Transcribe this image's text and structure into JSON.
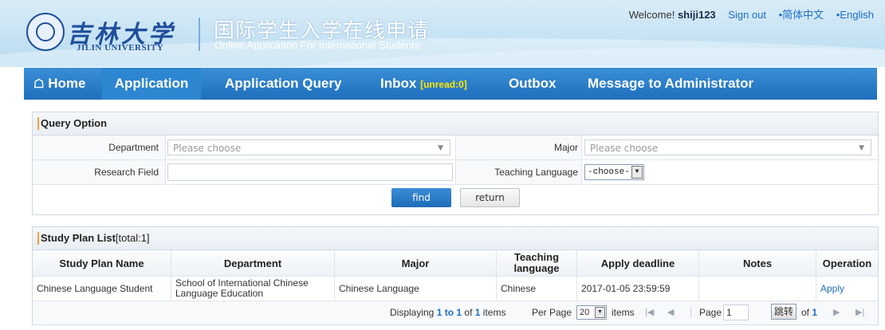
{
  "header": {
    "logo_cn": "吉林大学",
    "logo_en": "JILIN UNIVERSITY",
    "title_cn": "国际学生入学在线申请",
    "title_en": "Online Application For International Students",
    "welcome_prefix": "Welcome!",
    "username": "shiji123",
    "sign_out": "Sign out",
    "lang_cn": "•简体中文",
    "lang_en": "•English"
  },
  "nav": {
    "home": "Home",
    "application": "Application",
    "application_query": "Application Query",
    "inbox": "Inbox",
    "inbox_unread": "[unread:0]",
    "outbox": "Outbox",
    "message_admin": "Message to Administrator"
  },
  "query": {
    "title": "Query Option",
    "department_label": "Department",
    "department_value": "Please choose",
    "major_label": "Major",
    "major_value": "Please choose",
    "research_label": "Research Field",
    "research_value": "",
    "teaching_label": "Teaching Language",
    "teaching_value": "-choose-",
    "find": "find",
    "return": "return"
  },
  "list": {
    "title": "Study Plan List",
    "total": "[total:1]",
    "columns": [
      "Study Plan Name",
      "Department",
      "Major",
      "Teaching language",
      "Apply deadline",
      "Notes",
      "Operation"
    ],
    "rows": [
      {
        "name": "Chinese Language Student",
        "department": "School of International Chinese Language Education",
        "major": "Chinese Language",
        "language": "Chinese",
        "deadline": "2017-01-05 23:59:59",
        "notes": "",
        "operation": "Apply"
      }
    ]
  },
  "pager": {
    "displaying": "Displaying",
    "range": "1 to 1",
    "of": "of",
    "total": "1",
    "items": "items",
    "per_page_label": "Per Page",
    "per_page_value": "20",
    "items2": "items",
    "page_label": "Page",
    "page_value": "1",
    "jump": "跳转",
    "of2": "of",
    "pages": "1"
  },
  "colors": {
    "nav_blue": "#1f6fbd",
    "link_blue": "#1e6fc4",
    "unread_yellow": "#ffe600",
    "accent_orange": "#f2a13a"
  }
}
